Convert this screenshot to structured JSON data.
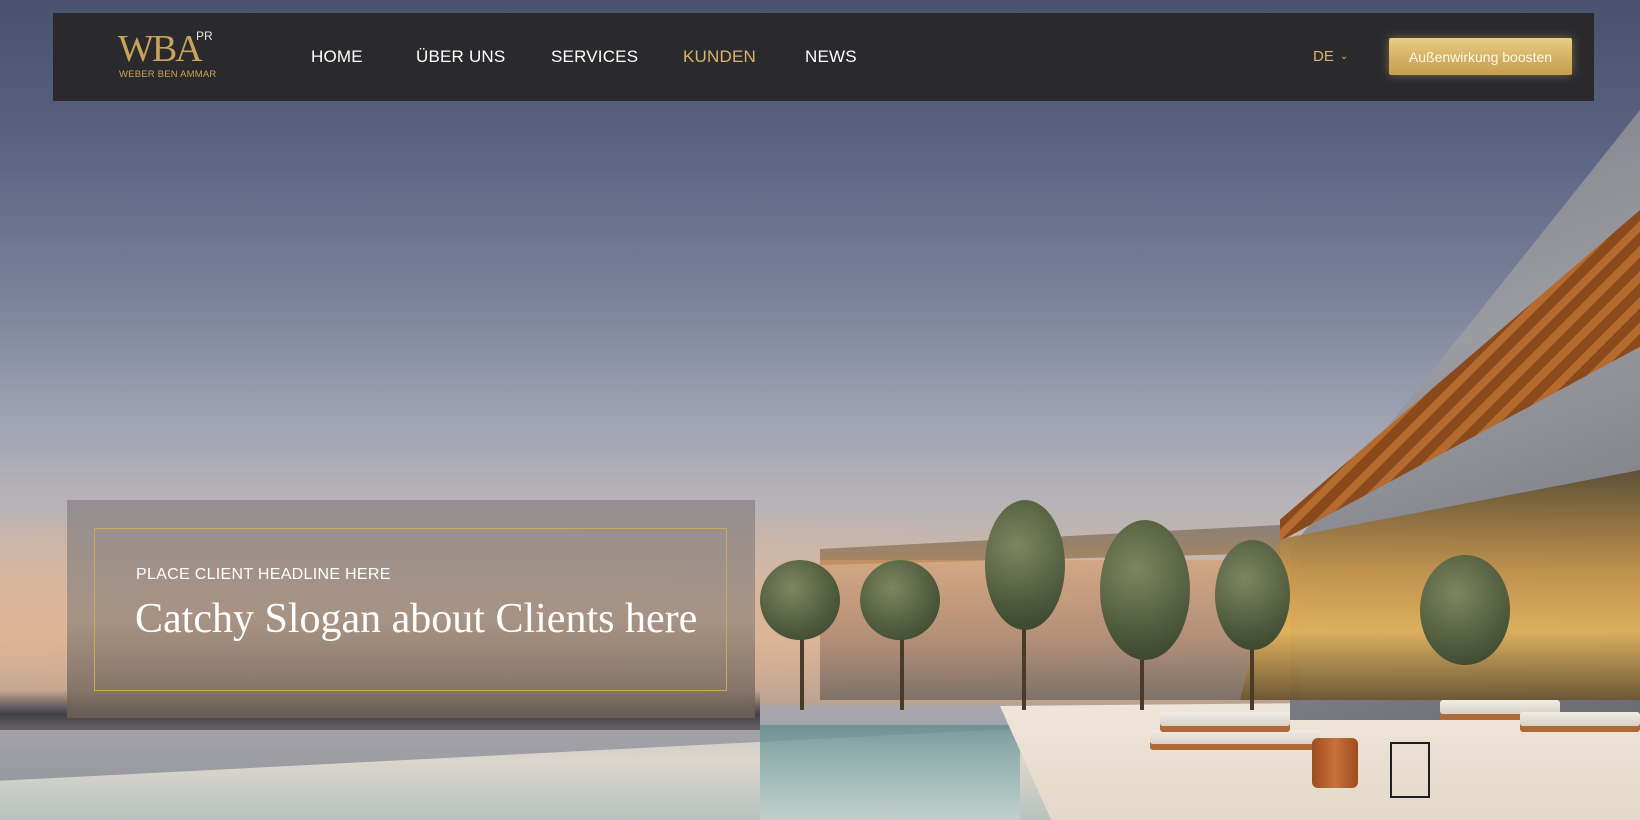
{
  "brand": {
    "logo_mark": "WBA",
    "logo_superscript": "PR",
    "logo_subtitle": "WEBER BEN AMMAR",
    "accent_color": "#d9b56a"
  },
  "nav": {
    "items": [
      {
        "label": "HOME",
        "active": false
      },
      {
        "label": "ÜBER UNS",
        "active": false
      },
      {
        "label": "SERVICES",
        "active": false
      },
      {
        "label": "KUNDEN",
        "active": true
      },
      {
        "label": "NEWS",
        "active": false
      }
    ],
    "language": "DE",
    "language_icon": "chevron-down-icon",
    "cta_label": "Außenwirkung boosten"
  },
  "hero": {
    "client_headline": "PLACE CLIENT HEADLINE HERE",
    "client_slogan": "Catchy Slogan about Clients here"
  }
}
